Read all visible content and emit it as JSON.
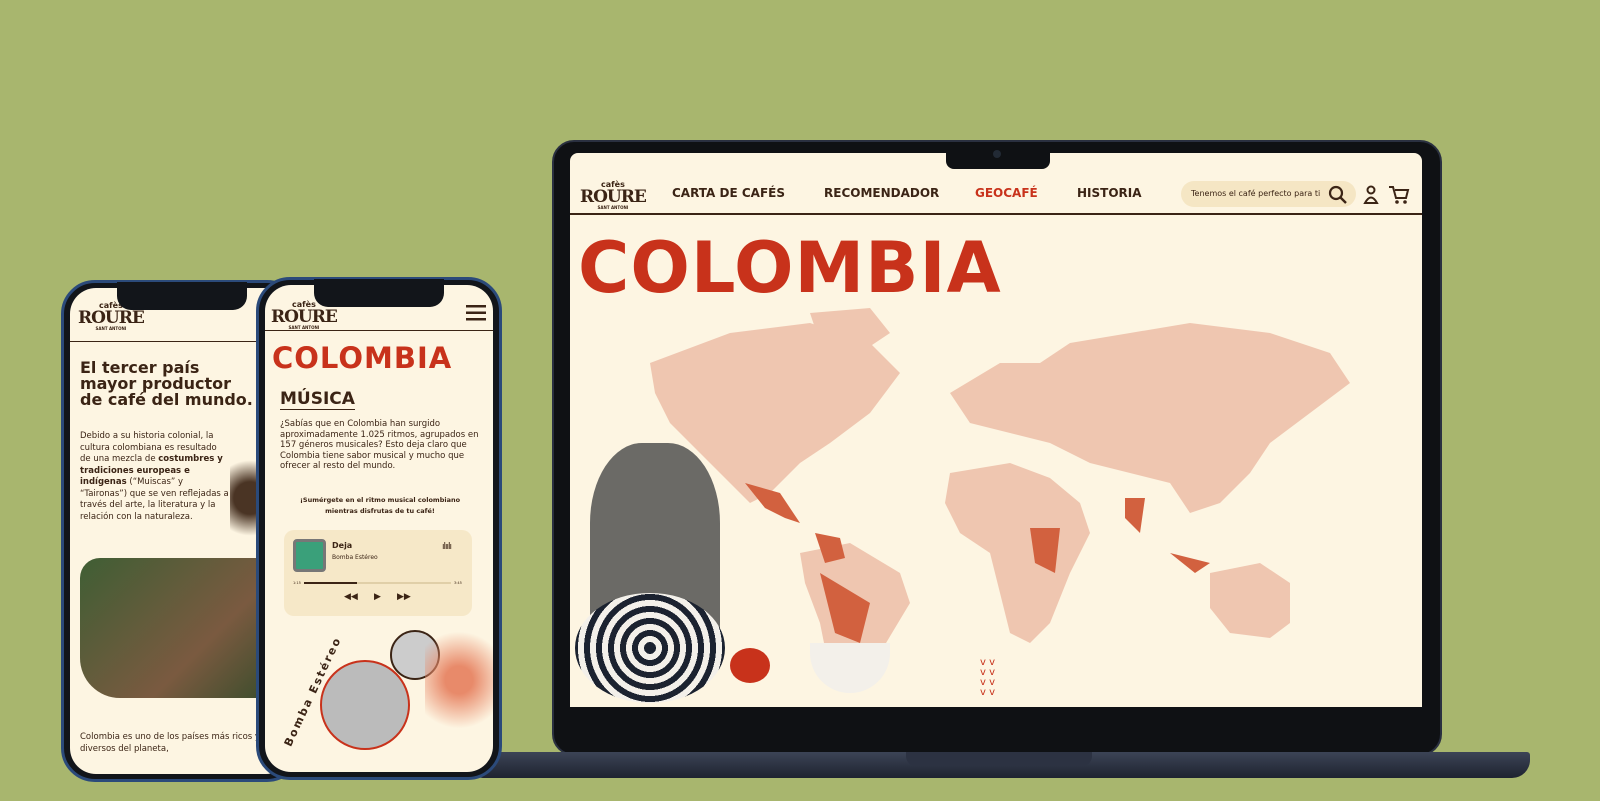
{
  "brand": {
    "small": "cafès",
    "name": "ROURE",
    "tagline": "SANT ANTONI"
  },
  "laptop": {
    "nav": [
      {
        "label": "CARTA DE CAFÉS",
        "active": false
      },
      {
        "label": "RECOMENDADOR",
        "active": false
      },
      {
        "label": "GEOCAFÉ",
        "active": true
      },
      {
        "label": "HISTORIA",
        "active": false
      }
    ],
    "search_placeholder": "Tenemos el café perfecto para ti",
    "icons": [
      "search-icon",
      "user-icon",
      "cart-icon"
    ],
    "title": "COLOMBIA"
  },
  "phone1": {
    "heading": "El tercer país mayor productor de café del mundo.",
    "body_1": "Debido a su historia colonial, la cultura colombiana es resultado de una mezcla de ",
    "body_bold": "costumbres y tradiciones europeas e indígenas",
    "body_2": " (“Muiscas” y “Taironas”) que se ven reflejadas a través del arte, la literatura y la relación con la naturaleza.",
    "footer": "Colombia es uno de los países más ricos y diversos del planeta,"
  },
  "phone2": {
    "title": "COLOMBIA",
    "section": "MÚSICA",
    "body": "¿Sabías que en Colombia han surgido aproximadamente 1.025 ritmos, agrupados en 157 géneros musicales? Esto deja claro que Colombia tiene sabor musical y mucho que ofrecer al resto del mundo.",
    "cta": "¡Sumérgete en el ritmo musical colombiano mientras disfrutas de tu café!",
    "player": {
      "track": "Deja",
      "artist": "Bomba Estéreo",
      "elapsed": "1:15",
      "duration": "3:45",
      "progress": 0.36
    },
    "band_label": "Bomba Estéreo"
  },
  "colors": {
    "background": "#a8b66e",
    "accent": "#c8321b",
    "text": "#3b2415",
    "page": "#fdf5e2",
    "map": "#efc6b0",
    "highlight": "#d2613f"
  }
}
